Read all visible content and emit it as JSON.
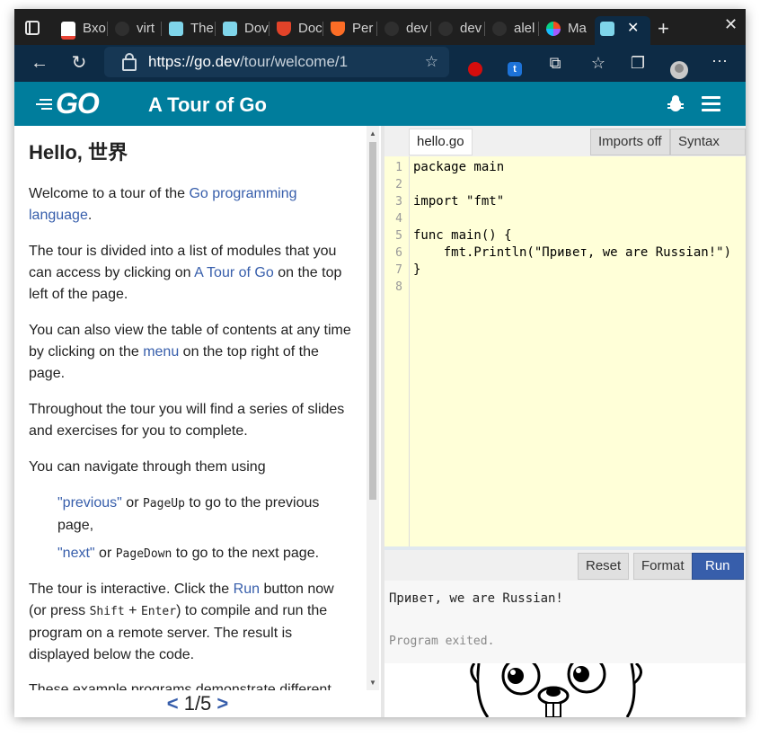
{
  "browser": {
    "tabs": [
      {
        "label": "Bxo",
        "icon": "gmail-icon",
        "color": "#ea4335"
      },
      {
        "label": "virt",
        "icon": "github-icon",
        "color": "#2f2f2f"
      },
      {
        "label": "The",
        "icon": "gopher-icon",
        "color": "#7fd5ea"
      },
      {
        "label": "Dov",
        "icon": "gopher-icon",
        "color": "#7fd5ea"
      },
      {
        "label": "Doc",
        "icon": "gitlab-icon",
        "color": "#e24329"
      },
      {
        "label": "Per",
        "icon": "gitlab-icon",
        "color": "#fc6d26"
      },
      {
        "label": "dev",
        "icon": "github-icon",
        "color": "#2f2f2f"
      },
      {
        "label": "dev",
        "icon": "github-icon",
        "color": "#2f2f2f"
      },
      {
        "label": "alel",
        "icon": "github-icon",
        "color": "#2f2f2f"
      },
      {
        "label": "Ma",
        "icon": "multicolor-icon",
        "color": "#a259ff"
      }
    ],
    "active_tab_icon": "gopher-icon",
    "url_host": "https://go.dev",
    "url_path": "/tour/welcome/1"
  },
  "header": {
    "logo_text": "GO",
    "title": "A Tour of Go"
  },
  "lesson": {
    "heading": "Hello, 世界",
    "p1_a": "Welcome to a tour of the ",
    "p1_link": "Go programming language",
    "p1_b": ".",
    "p2_a": "The tour is divided into a list of modules that you can access by clicking on ",
    "p2_link": "A Tour of Go",
    "p2_b": " on the top left of the page.",
    "p3_a": "You can also view the table of contents at any time by clicking on the ",
    "p3_link": "menu",
    "p3_b": " on the top right of the page.",
    "p4": "Throughout the tour you will find a series of slides and exercises for you to complete.",
    "p5": "You can navigate through them using",
    "prev_link": "\"previous\"",
    "prev_or": " or ",
    "prev_key": "PageUp",
    "prev_rest": " to go to the previous page,",
    "next_link": "\"next\"",
    "next_or": " or ",
    "next_key": "PageDown",
    "next_rest": " to go to the next page.",
    "p6_a": "The tour is interactive. Click the ",
    "p6_link": "Run",
    "p6_b": " button now (or press ",
    "p6_key1": "Shift",
    "p6_plus": " + ",
    "p6_key2": "Enter",
    "p6_c": ") to compile and run the program on a remote server. The result is displayed below the code.",
    "p7": "These example programs demonstrate different"
  },
  "pager": {
    "prev": "<",
    "position": "1/5",
    "next": ">"
  },
  "editor": {
    "filename": "hello.go",
    "imports_btn": "Imports off",
    "syntax_btn": "Syntax off",
    "line_numbers": [
      "1",
      "2",
      "3",
      "4",
      "5",
      "6",
      "7",
      "8"
    ],
    "lines": [
      "package main",
      "",
      "import \"fmt\"",
      "",
      "func main() {",
      "    fmt.Println(\"Привет, we are Russian!\")",
      "}",
      ""
    ]
  },
  "output": {
    "reset_btn": "Reset",
    "format_btn": "Format",
    "run_btn": "Run",
    "result": "Привет, we are Russian!",
    "exit_msg": "Program exited."
  }
}
